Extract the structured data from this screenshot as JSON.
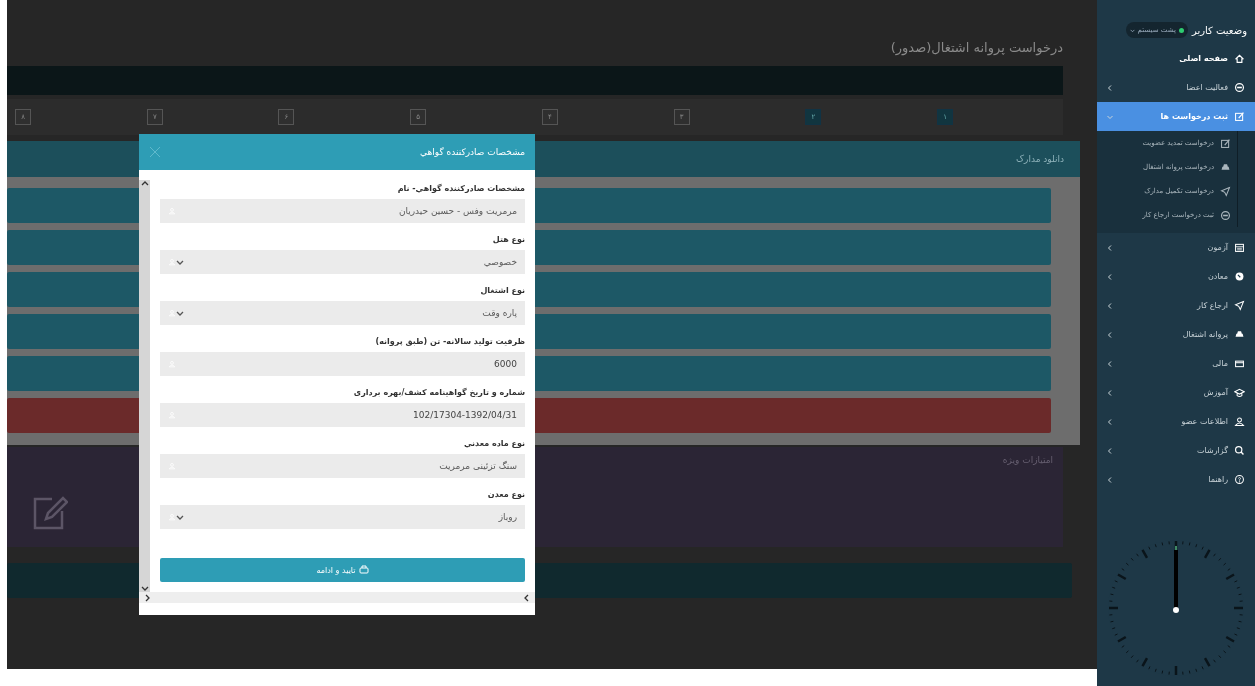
{
  "page": {
    "title": "درخواست پروانه اشتغال(صدور)"
  },
  "steps": [
    {
      "label": "۱",
      "completed": true
    },
    {
      "label": "۲",
      "completed": true
    },
    {
      "label": "۳",
      "completed": false
    },
    {
      "label": "۴",
      "completed": false
    },
    {
      "label": "۵",
      "completed": false
    },
    {
      "label": "۶",
      "completed": false
    },
    {
      "label": "۷",
      "completed": false
    },
    {
      "label": "۸",
      "completed": false
    }
  ],
  "documents_panel": {
    "title": "دانلود مدارک",
    "rows": [
      {
        "kind": "normal"
      },
      {
        "kind": "normal"
      },
      {
        "kind": "normal"
      },
      {
        "kind": "normal"
      },
      {
        "kind": "normal"
      },
      {
        "kind": "alert"
      }
    ]
  },
  "special_panel": {
    "title": "امتیازات ویژه"
  },
  "modal": {
    "title": "مشخصات صادرکننده گواهي",
    "fields": [
      {
        "label": "مشخصات صادرکننده گواهي- نام",
        "value": "مرمریت وفس - حسین حیدریان",
        "kind": "text"
      },
      {
        "label": "نوع هتل",
        "value": "خصوصي",
        "kind": "select"
      },
      {
        "label": "نوع اشتغال",
        "value": "پاره وقت",
        "kind": "select"
      },
      {
        "label": "ظرفیت تولید سالانه- تن (طبق پروانه)",
        "value": "6000",
        "kind": "text"
      },
      {
        "label": "شماره و تاریخ گواهینامه کشف/بهره برداری",
        "value": "102/17304-1392/04/31",
        "kind": "text"
      },
      {
        "label": "نوع ماده معدني",
        "value": "سنگ تزئینی مرمریت",
        "kind": "text"
      },
      {
        "label": "نوع معدن",
        "value": "روباز",
        "kind": "select"
      }
    ],
    "submit": "تایید و ادامه"
  },
  "sidebar": {
    "title": "وضعیت کاربر",
    "status": {
      "label": "پشت سیستم",
      "online": true
    },
    "items": [
      {
        "label": "صفحه اصلی",
        "kind": "link",
        "selected": false
      },
      {
        "label": "فعالیت اعضا",
        "kind": "group",
        "selected": false,
        "expanded": false
      },
      {
        "label": "ثبت درخواست ها",
        "kind": "group",
        "selected": true,
        "expanded": true,
        "children": [
          {
            "label": "درخواست تمدید عضویت"
          },
          {
            "label": "درخواست پروانه اشتغال"
          },
          {
            "label": "درخواست تکمیل مدارک"
          },
          {
            "label": "ثبت درخواست ارجاع کار"
          }
        ]
      },
      {
        "label": "آزمون",
        "kind": "group",
        "selected": false,
        "expanded": false
      },
      {
        "label": "معادن",
        "kind": "group",
        "selected": false,
        "expanded": false
      },
      {
        "label": "ارجاع کار",
        "kind": "group",
        "selected": false,
        "expanded": false
      },
      {
        "label": "پروانه اشتغال",
        "kind": "group",
        "selected": false,
        "expanded": false
      },
      {
        "label": "مالی",
        "kind": "group",
        "selected": false,
        "expanded": false
      },
      {
        "label": "آموزش",
        "kind": "group",
        "selected": false,
        "expanded": false
      },
      {
        "label": "اطلاعات عضو",
        "kind": "group",
        "selected": false,
        "expanded": false
      },
      {
        "label": "گزارشات",
        "kind": "group",
        "selected": false,
        "expanded": false
      },
      {
        "label": "راهنما",
        "kind": "group",
        "selected": false,
        "expanded": false
      }
    ]
  }
}
